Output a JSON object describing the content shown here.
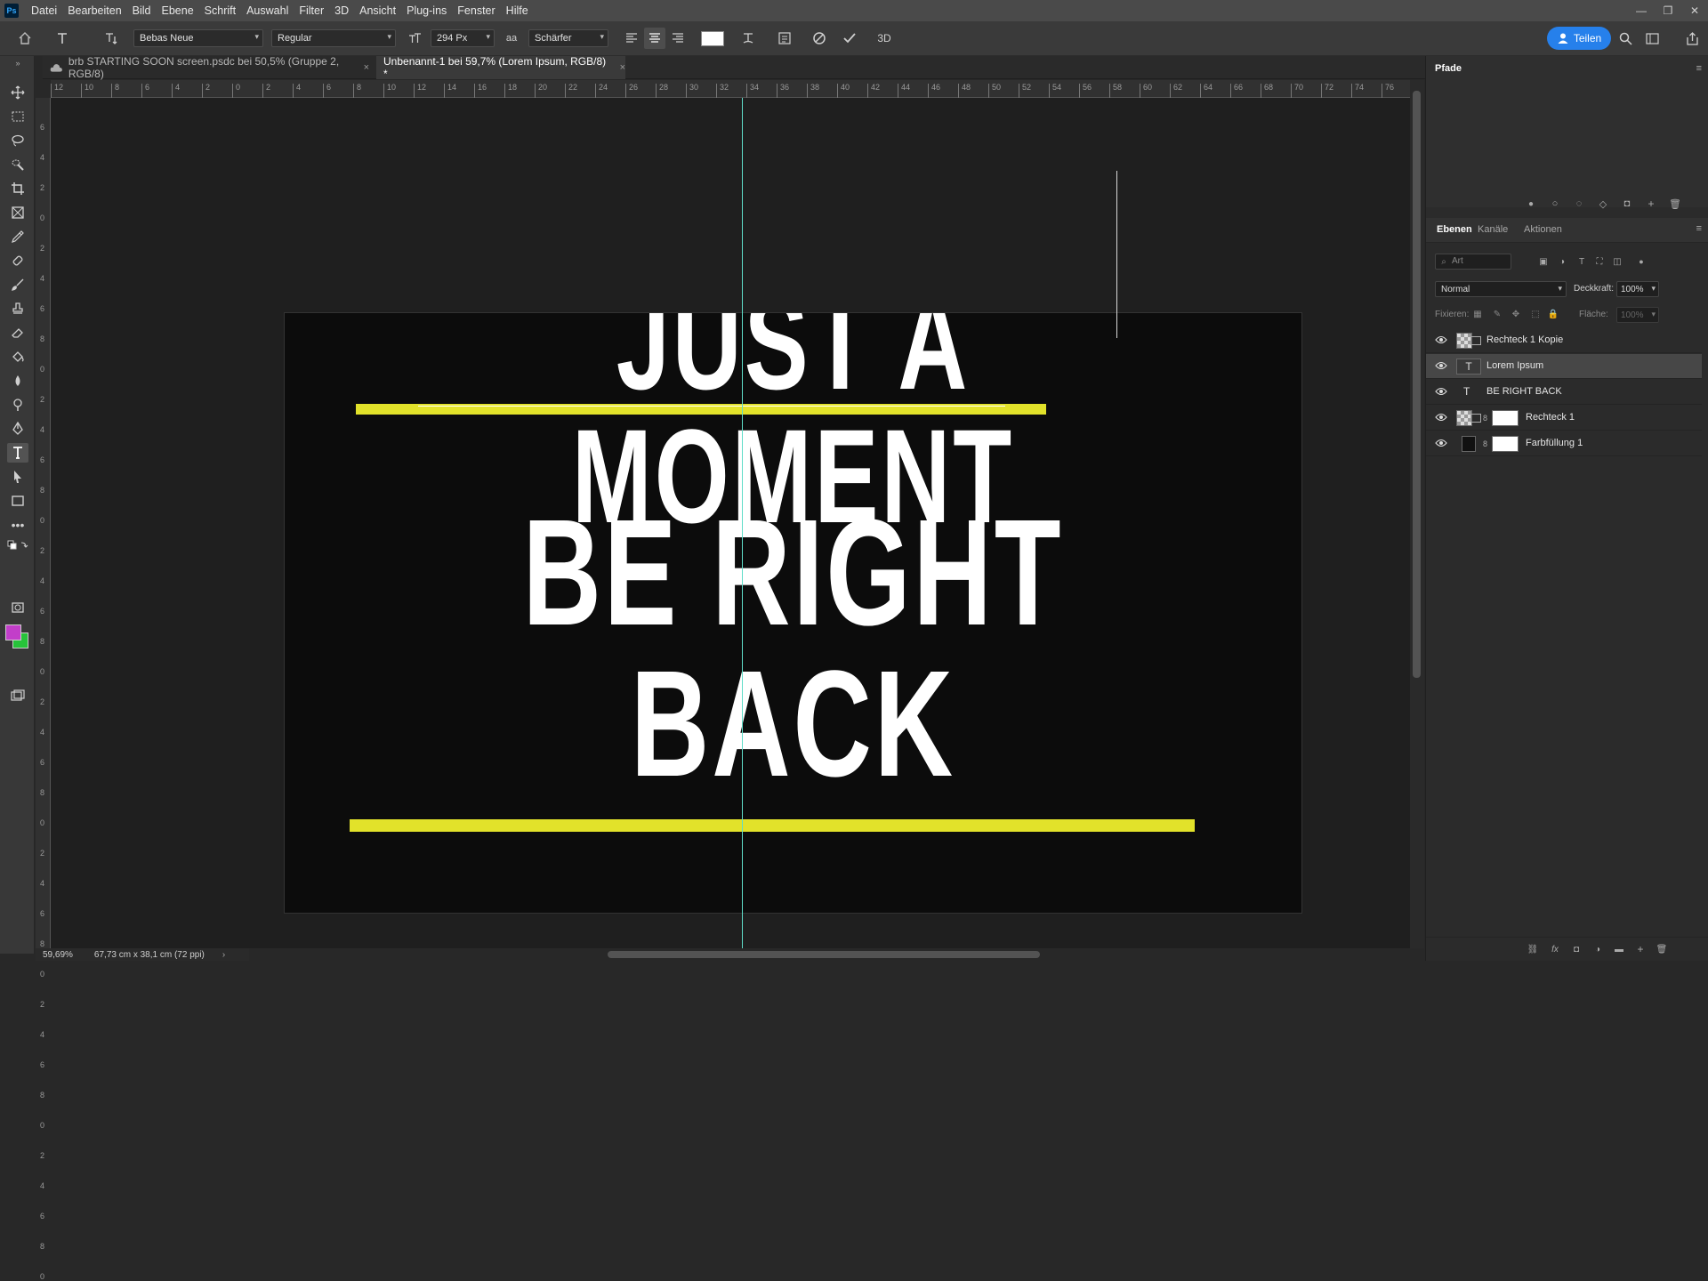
{
  "menubar": {
    "items": [
      "Datei",
      "Bearbeiten",
      "Bild",
      "Ebene",
      "Schrift",
      "Auswahl",
      "Filter",
      "3D",
      "Ansicht",
      "Plug-ins",
      "Fenster",
      "Hilfe"
    ]
  },
  "options": {
    "font_family": "Bebas Neue",
    "font_style": "Regular",
    "font_size": "294 Px",
    "antialias": "Schärfer",
    "text_color": "#ffffff",
    "share_label": "Teilen",
    "threed_label": "3D"
  },
  "tabs": [
    {
      "label": "brb STARTING SOON screen.psdc bei 50,5% (Gruppe 2, RGB/8)",
      "active": false
    },
    {
      "label": "Unbenannt-1 bei 59,7% (Lorem Ipsum, RGB/8) *",
      "active": true
    }
  ],
  "canvas": {
    "headline": "JUST A MOMENT",
    "main_text": "BE RIGHT BACK",
    "accent_color": "#e2e22a",
    "background_color": "#0c0c0c"
  },
  "ruler": {
    "top_ticks": [
      "12",
      "10",
      "8",
      "6",
      "4",
      "2",
      "0",
      "2",
      "4",
      "6",
      "8",
      "10",
      "12",
      "14",
      "16",
      "18",
      "20",
      "22",
      "24",
      "26",
      "28",
      "30",
      "32",
      "34",
      "36",
      "38",
      "40",
      "42",
      "44",
      "46",
      "48",
      "50",
      "52",
      "54",
      "56",
      "58",
      "60",
      "62",
      "64",
      "66",
      "68",
      "70",
      "72",
      "74",
      "76"
    ],
    "left_ticks": [
      "6",
      "4",
      "2",
      "0",
      "2",
      "4",
      "6",
      "8",
      "0",
      "2",
      "4",
      "6",
      "8",
      "0",
      "2",
      "4",
      "6",
      "8",
      "0",
      "2",
      "4",
      "6",
      "8",
      "0",
      "2",
      "4",
      "6",
      "8",
      "0",
      "2",
      "4",
      "6",
      "8",
      "0",
      "2",
      "4",
      "6",
      "8",
      "0"
    ]
  },
  "status": {
    "zoom": "59,69%",
    "doc_size": "67,73 cm x 38,1 cm (72 ppi)"
  },
  "paths_panel": {
    "title": "Pfade"
  },
  "layers_panel": {
    "tabs": [
      "Ebenen",
      "Kanäle",
      "Aktionen"
    ],
    "search_placeholder": "Art",
    "blend_mode": "Normal",
    "opacity_label": "Deckkraft:",
    "opacity_value": "100%",
    "lock_label": "Fixieren:",
    "fill_label": "Fläche:",
    "fill_value": "100%",
    "layers": [
      {
        "name": "Rechteck 1 Kopie",
        "type": "shape",
        "selected": false
      },
      {
        "name": "Lorem Ipsum",
        "type": "text",
        "selected": true
      },
      {
        "name": "BE RIGHT BACK",
        "type": "text",
        "selected": false
      },
      {
        "name": "Rechteck 1",
        "type": "shape-mask",
        "selected": false
      },
      {
        "name": "Farbfüllung 1",
        "type": "fill",
        "selected": false
      }
    ]
  }
}
